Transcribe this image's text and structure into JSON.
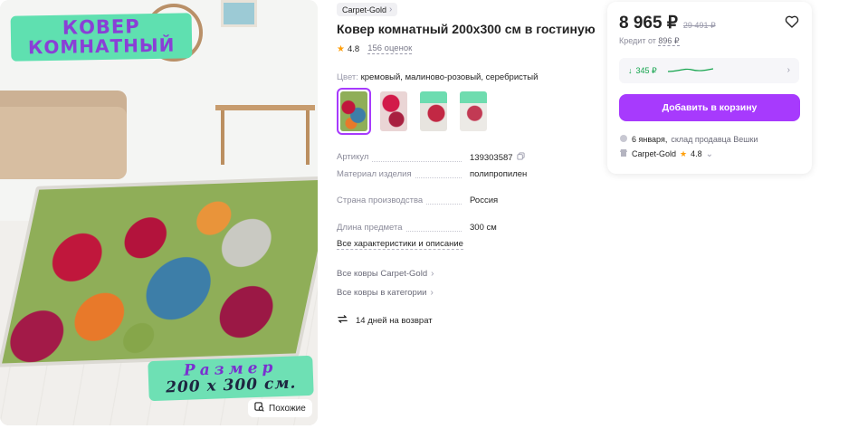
{
  "gallery": {
    "banner_line1": "КОВЕР",
    "banner_line2": "КОМНАТНЫЙ",
    "size_line1": "Размер",
    "size_line2": "200 x 300 см.",
    "similar_label": "Похожие"
  },
  "product": {
    "brand": "Carpet-Gold",
    "title": "Ковер комнатный 200х300 см в гостиную",
    "rating": "4.8",
    "reviews": "156 оценок",
    "color_label": "Цвет:",
    "color_value": "кремовый, малиново-розовый, серебристый"
  },
  "specs": [
    {
      "label": "Артикул",
      "value": "139303587"
    },
    {
      "label": "Материал изделия",
      "value": "полипропилен"
    },
    {
      "label": "Страна производства",
      "value": "Россия"
    },
    {
      "label": "Длина предмета",
      "value": "300 см"
    }
  ],
  "links": {
    "all_specs": "Все характеристики и описание",
    "all_brand": "Все ковры Carpet-Gold",
    "all_category": "Все ковры в категории",
    "return": "14 дней на возврат"
  },
  "price_card": {
    "price": "8 965 ₽",
    "old_price": "29 491 ₽",
    "credit_prefix": "Кредит от",
    "credit_amount": "896 ₽",
    "cashback": "345 ₽",
    "add_to_cart": "Добавить в корзину",
    "delivery_date": "6 января,",
    "delivery_source": "склад продавца Вешки",
    "seller": "Carpet-Gold",
    "seller_rating": "4.8"
  },
  "colors": {
    "accent": "#a73afd",
    "cashback_green": "#14a44d",
    "star": "#ff9f0a",
    "banner_mint": "#5fe0b0"
  }
}
